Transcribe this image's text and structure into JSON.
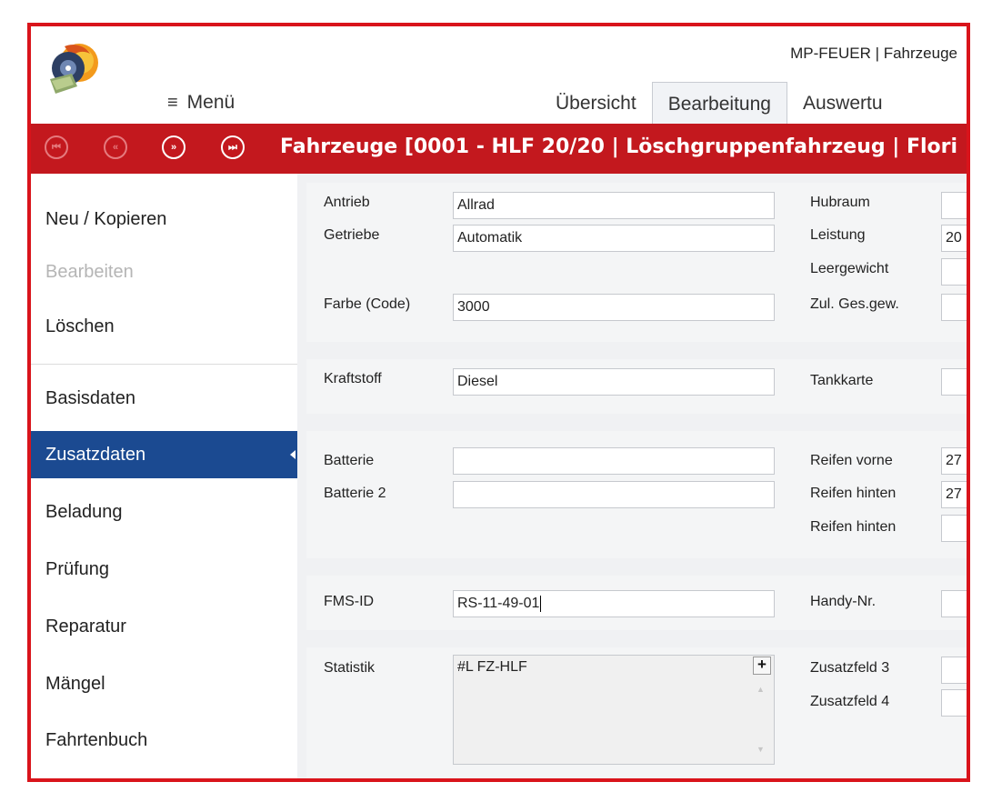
{
  "header": {
    "app_title": "MP-FEUER | Fahrzeuge",
    "menu_label": "Menü",
    "menu_icon": "≡",
    "tabs": [
      {
        "label": "Übersicht"
      },
      {
        "label": "Bearbeitung"
      },
      {
        "label": "Auswertu"
      }
    ]
  },
  "navbar": {
    "title": "Fahrzeuge  [0001 - HLF 20/20 | Löschgruppenfahrzeug | Flori",
    "buttons": [
      {
        "icon": "first-record-icon",
        "glyph": "⏮",
        "enabled": false
      },
      {
        "icon": "previous-record-icon",
        "glyph": "«",
        "enabled": false
      },
      {
        "icon": "next-record-icon",
        "glyph": "»",
        "enabled": true
      },
      {
        "icon": "last-record-icon",
        "glyph": "⏭",
        "enabled": true
      }
    ]
  },
  "sidebar": {
    "items": [
      {
        "label": "Neu / Kopieren"
      },
      {
        "label": "Bearbeiten"
      },
      {
        "label": "Löschen"
      },
      {
        "label": "Basisdaten"
      },
      {
        "label": "Zusatzdaten"
      },
      {
        "label": "Beladung"
      },
      {
        "label": "Prüfung"
      },
      {
        "label": "Reparatur"
      },
      {
        "label": "Mängel"
      },
      {
        "label": "Fahrtenbuch"
      }
    ],
    "active_item": "Zusatzdaten"
  },
  "form": {
    "antrieb": {
      "label": "Antrieb",
      "value": "Allrad"
    },
    "getriebe": {
      "label": "Getriebe",
      "value": "Automatik"
    },
    "farbe": {
      "label": "Farbe (Code)",
      "value": "3000"
    },
    "hubraum": {
      "label": "Hubraum",
      "value": ""
    },
    "leistung": {
      "label": "Leistung",
      "value": "20"
    },
    "leergewicht": {
      "label": "Leergewicht",
      "value": ""
    },
    "zul_gesgew": {
      "label": "Zul. Ges.gew.",
      "value": ""
    },
    "kraftstoff": {
      "label": "Kraftstoff",
      "value": "Diesel"
    },
    "tankkarte": {
      "label": "Tankkarte",
      "value": ""
    },
    "batterie": {
      "label": "Batterie",
      "value": ""
    },
    "batterie2": {
      "label": "Batterie 2",
      "value": ""
    },
    "reifen_vorne": {
      "label": "Reifen vorne",
      "value": "27"
    },
    "reifen_hinten": {
      "label": "Reifen hinten",
      "value": "27"
    },
    "reifen_hinten2": {
      "label": "Reifen hinten",
      "value": ""
    },
    "fms_id": {
      "label": "FMS-ID",
      "value": "RS-11-49-01"
    },
    "handy": {
      "label": "Handy-Nr.",
      "value": ""
    },
    "statistik": {
      "label": "Statistik",
      "value": "#L FZ-HLF",
      "add_label": "+"
    },
    "zusatzfeld3": {
      "label": "Zusatzfeld 3",
      "value": ""
    },
    "zusatzfeld4": {
      "label": "Zusatzfeld 4",
      "value": ""
    }
  },
  "colors": {
    "accent_red": "#c3181e",
    "active_blue": "#1b4a91",
    "frame_red": "#d9141b"
  }
}
